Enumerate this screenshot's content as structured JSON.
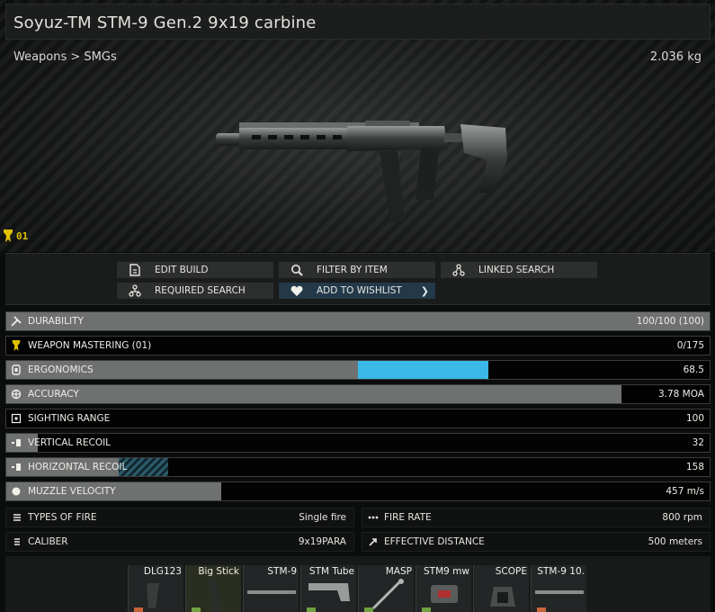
{
  "item": {
    "title": "Soyuz-TM STM-9 Gen.2 9x19 carbine",
    "breadcrumb": "Weapons > SMGs",
    "weight": "2.036 kg",
    "mastery_badge": "01"
  },
  "actions": {
    "edit_build": "EDIT BUILD",
    "filter_by_item": "FILTER BY ITEM",
    "linked_search": "LINKED SEARCH",
    "required_search": "REQUIRED SEARCH",
    "add_to_wishlist": "ADD TO WISHLIST"
  },
  "stats": [
    {
      "label": "DURABILITY",
      "value": "100/100 (100)",
      "fill": 1.0,
      "icon": "wrench-icon"
    },
    {
      "label": "WEAPON MASTERING (01)",
      "value": "0/175",
      "fill": 0.0,
      "icon": "mastery-icon"
    },
    {
      "label": "ERGONOMICS",
      "value": "68.5",
      "fill": 0.5,
      "bonus": 0.185,
      "icon": "grip-icon"
    },
    {
      "label": "ACCURACY",
      "value": "3.78 MOA",
      "fill": 0.875,
      "icon": "crosshair-icon"
    },
    {
      "label": "SIGHTING RANGE",
      "value": "100",
      "fill": 0.0,
      "icon": "sight-icon"
    },
    {
      "label": "VERTICAL RECOIL",
      "value": "32",
      "fill": 0.045,
      "icon": "recoil-vertical-icon"
    },
    {
      "label": "HORIZONTAL RECOIL",
      "value": "158",
      "fill": 0.16,
      "penalty": 0.07,
      "icon": "recoil-horizontal-icon"
    },
    {
      "label": "MUZZLE VELOCITY",
      "value": "457 m/s",
      "fill": 0.305,
      "icon": "velocity-icon"
    }
  ],
  "info": {
    "types_of_fire_label": "TYPES OF FIRE",
    "types_of_fire_value": "Single fire",
    "fire_rate_label": "FIRE RATE",
    "fire_rate_value": "800 rpm",
    "caliber_label": "CALIBER",
    "caliber_value": "9x19PARA",
    "effective_distance_label": "EFFECTIVE DISTANCE",
    "effective_distance_value": "500 meters"
  },
  "slots": [
    {
      "label": "DLG123",
      "dot": "#c8643a"
    },
    {
      "label": "Big Stick",
      "dot": "#6fa040"
    },
    {
      "label": "STM-9",
      "dot": ""
    },
    {
      "label": "STM Tube",
      "dot": "#6fa040"
    },
    {
      "label": "MASP",
      "dot": "#6fa040"
    },
    {
      "label": "STM9 mw",
      "dot": "#6fa040"
    },
    {
      "label": "SCOPE",
      "dot": ""
    },
    {
      "label": "STM-9 10.",
      "dot": "#c8643a"
    }
  ],
  "colors": {
    "accent_blue": "#3ab8e8",
    "stat_fill": "#6f7070",
    "wishlist_bg": "#23394a",
    "mastery_gold": "#e0c000"
  }
}
